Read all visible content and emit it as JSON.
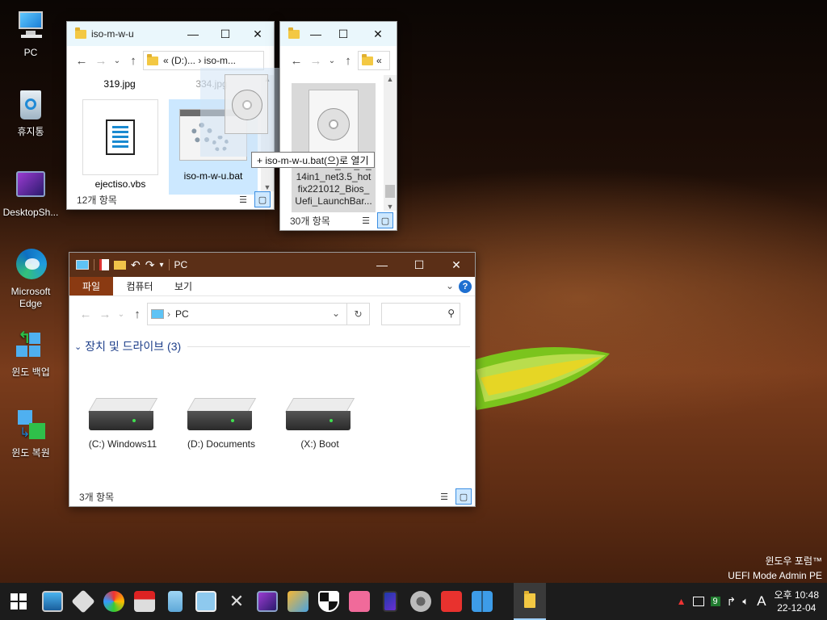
{
  "desktop": {
    "icons": [
      {
        "label": "PC"
      },
      {
        "label": "휴지통"
      },
      {
        "label": "DesktopSh..."
      },
      {
        "label": "Microsoft Edge"
      },
      {
        "label": "윈도 백업"
      },
      {
        "label": "윈도 복원"
      }
    ],
    "watermark_line1": "윈도우 포럼™",
    "watermark_line2": "UEFI Mode Admin PE"
  },
  "window1": {
    "title": "iso-m-w-u",
    "address": "« (D:)...  ›  iso-m...",
    "files": [
      {
        "name": "319.jpg"
      },
      {
        "name": "334.jpg"
      },
      {
        "name": "ejectiso.vbs"
      },
      {
        "name": "iso-m-w-u.bat"
      }
    ],
    "status": "12개 항목"
  },
  "window2": {
    "title": "",
    "address": "«",
    "file_name": "Windows_8.1_K_14in1_net3.5_hotfix221012_Bios_Uefi_LaunchBar...",
    "status": "30개 항목"
  },
  "drag_tooltip": "+ iso-m-w-u.bat(으)로 열기",
  "pc_window": {
    "title": "PC",
    "ribbon_tabs": [
      "파일",
      "컴퓨터",
      "보기"
    ],
    "address": "PC",
    "section": "장치 및 드라이브 (3)",
    "drives": [
      {
        "label": "(C:) Windows11"
      },
      {
        "label": "(D:) Documents"
      },
      {
        "label": "(X:) Boot"
      }
    ],
    "status": "3개 항목"
  },
  "taskbar": {
    "icons": [
      "start-icon",
      "monitor-icon",
      "tools-icon",
      "disk-icon",
      "car-icon",
      "notepad-icon",
      "network-icon",
      "wrench-icon",
      "photo-icon",
      "remote-icon",
      "shield-icon",
      "windows-tiles-icon",
      "tablet-icon",
      "camera-icon",
      "anydesk-icon",
      "windows-icon",
      "explorer-icon"
    ],
    "tray_badge": "9",
    "ime": "A",
    "time": "오후 10:48",
    "date": "22-12-04"
  }
}
